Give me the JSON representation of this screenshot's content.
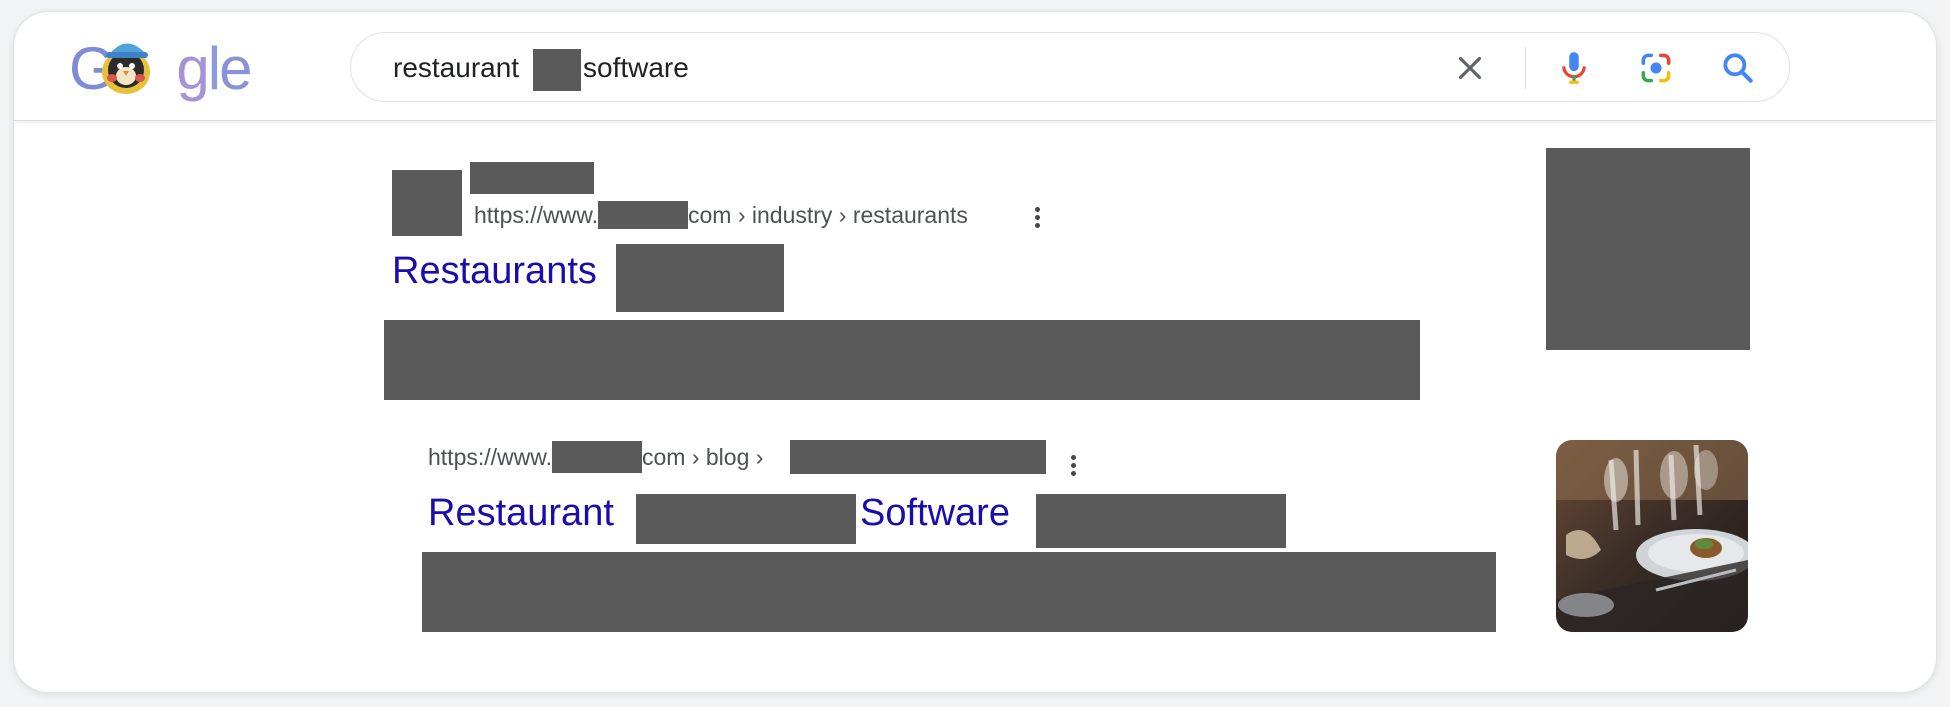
{
  "search": {
    "query_before": "restaurant",
    "query_after": "software"
  },
  "header": {
    "logo_text": "Google",
    "icons": [
      "close-icon",
      "microphone-icon",
      "lens-camera-icon",
      "search-icon"
    ]
  },
  "results": [
    {
      "url_prefix": "https://www.",
      "url_suffix": "com › industry › restaurants",
      "title_start": "Restaurants"
    },
    {
      "url_prefix": "https://www.",
      "url_suffix": "com › blog ›",
      "title_start": "Restaurant",
      "title_mid": "Software"
    }
  ],
  "colors": {
    "link": "#1a0dab",
    "url_text": "#4d5156",
    "redaction": "#5a5a5a"
  }
}
